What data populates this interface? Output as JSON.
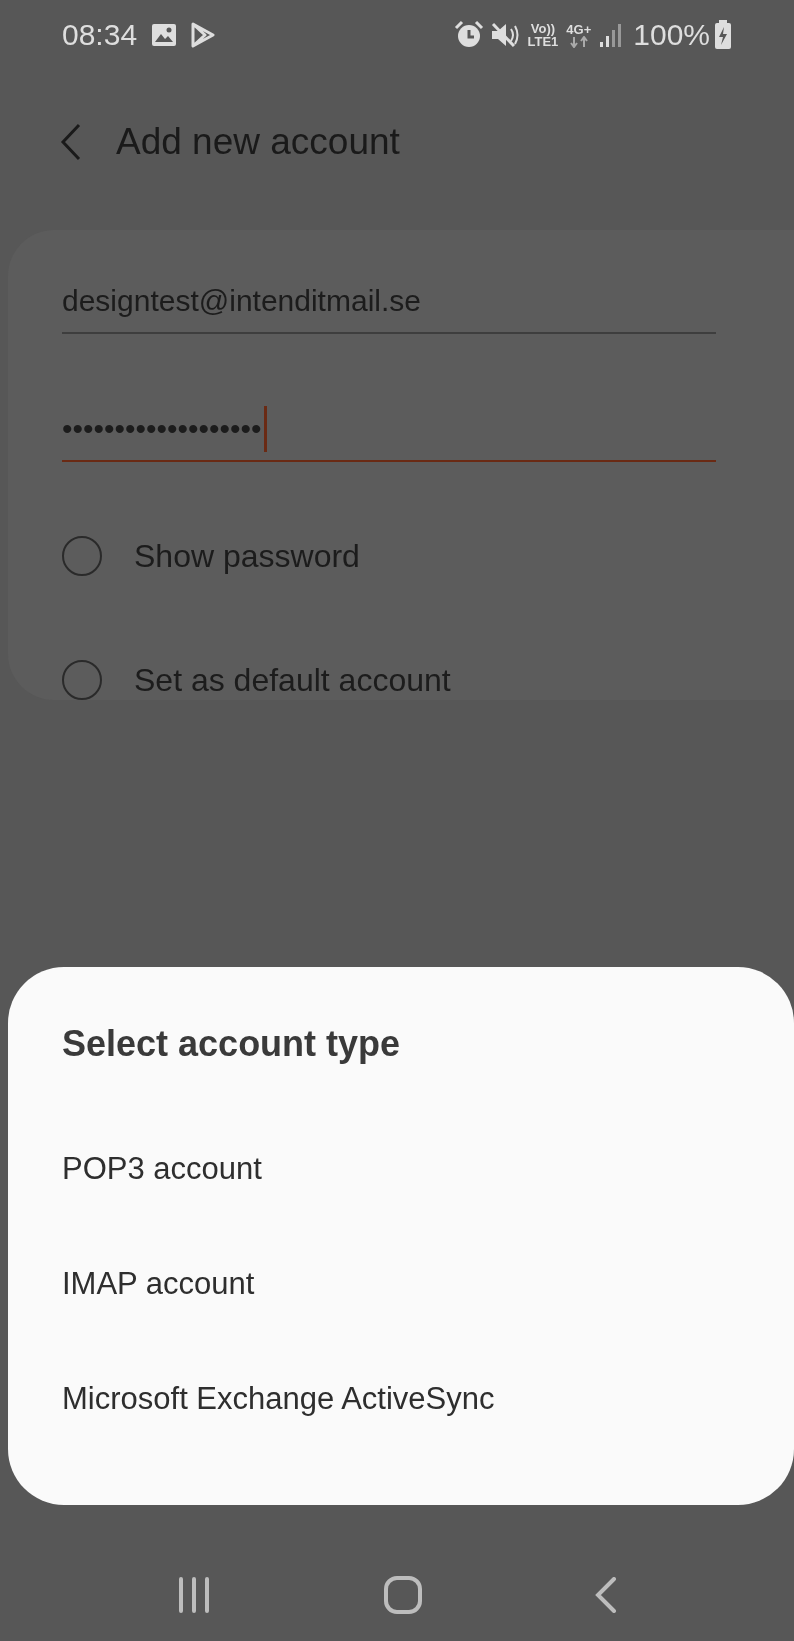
{
  "status_bar": {
    "time": "08:34",
    "volte": "Vo))",
    "lte": "LTE1",
    "network": "4G+",
    "battery": "100%"
  },
  "header": {
    "title": "Add new account"
  },
  "form": {
    "email": {
      "value": "designtest@intenditmail.se",
      "focused": false
    },
    "password": {
      "value": "•••••••••••••••••••",
      "focused": true
    },
    "options": [
      {
        "label": "Show password",
        "checked": false
      },
      {
        "label": "Set as default account",
        "checked": false
      }
    ]
  },
  "sheet": {
    "title": "Select account type",
    "items": [
      {
        "label": "POP3 account"
      },
      {
        "label": "IMAP account"
      },
      {
        "label": "Microsoft Exchange ActiveSync"
      }
    ]
  }
}
